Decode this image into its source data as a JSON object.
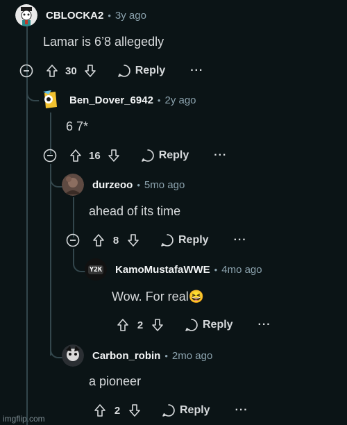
{
  "comments": [
    {
      "author": "CBLOCKA2",
      "time": "3y ago",
      "body": "Lamar is 6’8 allegedly",
      "votes": "30",
      "reply": "Reply",
      "more": "···"
    },
    {
      "author": "Ben_Dover_6942",
      "time": "2y ago",
      "body": "6 7*",
      "votes": "16",
      "reply": "Reply",
      "more": "···"
    },
    {
      "author": "durzeoo",
      "time": "5mo ago",
      "body": "ahead of its time",
      "votes": "8",
      "reply": "Reply",
      "more": "···"
    },
    {
      "author": "KamoMustafaWWE",
      "time": "4mo ago",
      "body": "Wow. For real",
      "emoji": "😆",
      "votes": "2",
      "reply": "Reply",
      "more": "···",
      "avatar_text": "Y2K"
    },
    {
      "author": "Carbon_robin",
      "time": "2mo ago",
      "body": "a pioneer",
      "votes": "2",
      "reply": "Reply",
      "more": "···"
    }
  ],
  "separator": "•",
  "watermark": "imgflip.com",
  "colors": {
    "background": "#0b1416",
    "text": "#d7dadc",
    "meta": "#8ba2ad",
    "thread": "#33464c"
  }
}
